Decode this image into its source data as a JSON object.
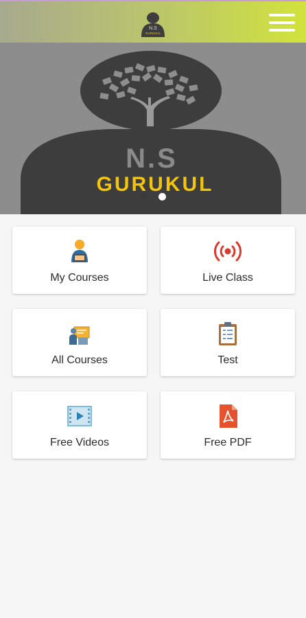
{
  "header": {
    "logo_text_line1": "N.S",
    "logo_text_line2": "GURUKUL",
    "menu_icon": "hamburger-menu-icon",
    "colors": {
      "gradient_start": "#a6aa8e",
      "gradient_end": "#d1e33c"
    }
  },
  "banner": {
    "brand_line1": "N.S",
    "brand_line2": "GURUKUL",
    "brand_color": "#f2c40c",
    "slides_total": 2,
    "active_slide": 2
  },
  "menu": [
    {
      "label": "My Courses",
      "icon": "student-reading-icon"
    },
    {
      "label": "Live Class",
      "icon": "live-broadcast-icon"
    },
    {
      "label": "All Courses",
      "icon": "teacher-board-icon"
    },
    {
      "label": "Test",
      "icon": "clipboard-checklist-icon"
    },
    {
      "label": "Free Videos",
      "icon": "video-play-icon"
    },
    {
      "label": "Free PDF",
      "icon": "pdf-file-icon"
    }
  ]
}
